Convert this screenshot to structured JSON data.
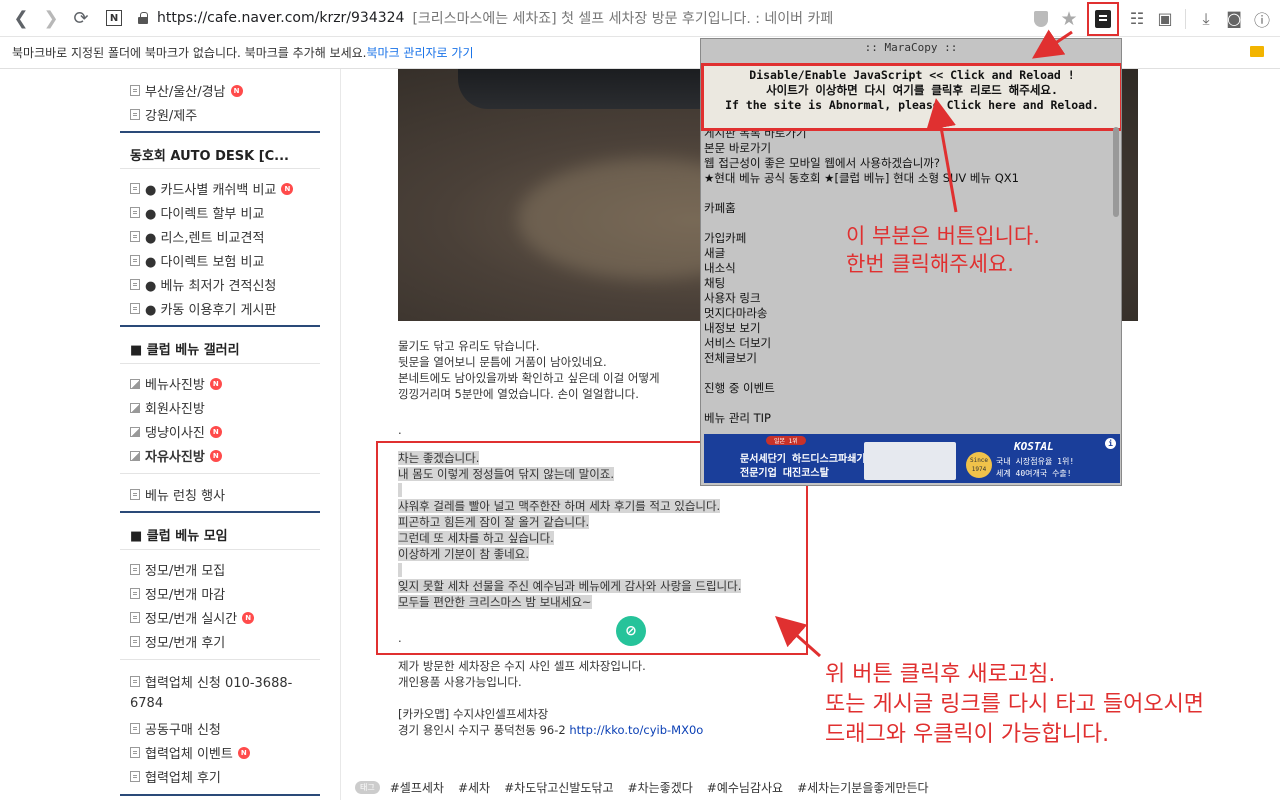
{
  "browser": {
    "url": "https://cafe.naver.com/krzr/934324",
    "title": "[크리스마스에는 세차죠] 첫 셀프 세차장 방문 후기입니다. : 네이버 카페",
    "bookmark_message": "북마크바로 지정된 폴더에 북마크가 없습니다. 북마크를 추가해 보세요. ",
    "bookmark_link": "북마크 관리자로 가기"
  },
  "sidebar": {
    "top_items": [
      "부산/울산/경남",
      "강원/제주"
    ],
    "group1_title": "동호회 AUTO DESK [C...",
    "group1_items": [
      "● 카드사별 캐쉬백 비교",
      "● 다이렉트 할부 비교",
      "● 리스,렌트 비교견적",
      "● 다이렉트 보험 비교",
      "● 베뉴 최저가 견적신청",
      "● 카동 이용후기 게시판"
    ],
    "group2_title": "■ 클럽 베뉴 갤러리",
    "group2_items": [
      "베뉴사진방",
      "회원사진방",
      "댕냥이사진",
      "자유사진방"
    ],
    "single_item": "베뉴 런칭 행사",
    "group3_title": "■ 클럽 베뉴 모임",
    "group3_items": [
      "정모/번개 모집",
      "정모/번개 마감",
      "정모/번개 실시간",
      "정모/번개 후기"
    ],
    "partner_items": [
      "협력업체 신청 010-3688-",
      "6784",
      "공동구매 신청",
      "협력업체 이벤트",
      "협력업체 후기"
    ]
  },
  "article": {
    "para1": [
      "물기도 닦고 유리도 닦습니다.",
      "뒷문을 열어보니 문틈에 거품이 남아있네요.",
      "본네트에도 남아있을까봐 확인하고 싶은데 이걸 어떻게",
      "낑낑거리며 5분만에 열었습니다. 손이 얼얼합니다."
    ],
    "dot1": ".",
    "para2": [
      "차는 좋겠습니다.",
      "내 몸도 이렇게 정성들여 닦지 않는데 말이죠."
    ],
    "para3": [
      "샤워후 걸레를 빨아 널고 맥주한잔 하며 세차 후기를 적고 있습니다.",
      "피곤하고 힘든게 잠이 잘 올거 같습니다.",
      "그런데 또 세차를 하고 싶습니다.",
      "이상하게 기분이 참 좋네요."
    ],
    "para4": [
      "잊지 못할 세차 선물을 주신 예수님과 베뉴에게 감사와 사랑을 드립니다.",
      "모두들 편안한 크리스마스 밤 보내세요~"
    ],
    "dot2": ".",
    "para5": [
      "제가 방문한 세차장은 수지 샤인 셀프 세차장입니다.",
      "개인용품 사용가능입니다."
    ],
    "kakao": "[카카오맵] 수지샤인셀프세차장",
    "address": "경기 용인시 수지구 풍덕천동 96-2 ",
    "address_link": "http://kko.to/cyib-MX0o",
    "tag_label": "태그",
    "tags": [
      "#셀프세차",
      "#세차",
      "#차도닦고신발도닦고",
      "#차는좋겠다",
      "#예수님감사요",
      "#세차는기분을좋게만든다"
    ]
  },
  "popup": {
    "title": ":: MaraCopy ::",
    "button_lines": [
      "Disable/Enable JavaScript << Click and Reload !",
      "사이트가 이상하면 다시 여기를 클릭후 리로드 해주세요.",
      "If the site is Abnormal, please Click here and Reload."
    ],
    "list": [
      "게시판 목록 바로가기",
      "본문 바로가기",
      "웹 접근성이 좋은 모바일 웹에서 사용하겠습니까?",
      "★현대 베뉴 공식 동호회 ★[클럽 베뉴] 현대 소형 SUV 베뉴 QX1",
      "",
      "카페홈",
      "",
      "가입카페",
      "새글",
      "내소식",
      "채팅",
      "사용자 링크",
      "멋지다마라송",
      "내정보 보기",
      "서비스 더보기",
      "전체글보기",
      "",
      "진행 중 이벤트",
      "",
      "베뉴 관리 TIP"
    ],
    "ad": {
      "badge": "일본 1위",
      "line1": "문서세단기 하드디스크파쇄기",
      "line2": "전문기업 대진코스탈",
      "since": "Since 1974",
      "brand": "KOSTAL",
      "line3": "국내 시장점유율 1위!",
      "line4": "세계 40여개국 수출!"
    }
  },
  "annotations": {
    "note1": [
      "이 부분은 버튼입니다.",
      "한번 클릭해주세요."
    ],
    "note2": [
      "위 버튼 클릭후 새로고침.",
      "또는 게시글 링크를 다시 타고 들어오시면",
      "드래그와 우클릭이 가능합니다."
    ]
  },
  "colors": {
    "annotation_red": "#e03030",
    "sidebar_rule": "#2a4a78",
    "new_badge": "#ff4b4b"
  },
  "icons": [
    "back-icon",
    "forward-icon",
    "reload-icon",
    "naver-icon",
    "lock-icon",
    "shield-icon",
    "star-icon",
    "maracopy-icon",
    "reader-icon",
    "sidebar-icon",
    "download-icon",
    "camera-icon",
    "info-icon"
  ]
}
